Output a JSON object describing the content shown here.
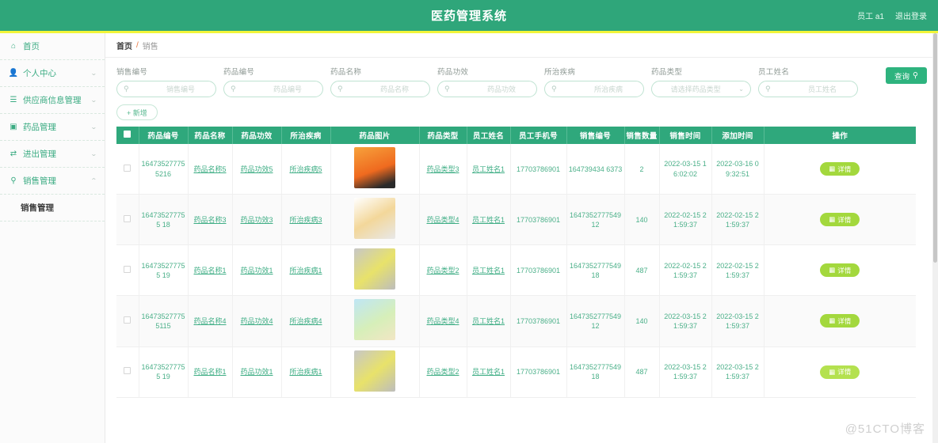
{
  "header": {
    "title": "医药管理系统",
    "user": "员工 a1",
    "logout": "退出登录"
  },
  "sidebar": {
    "items": [
      {
        "label": "首页",
        "icon": "home-icon",
        "glyph": "⌂",
        "arrow": "",
        "active": true
      },
      {
        "label": "个人中心",
        "icon": "user-icon",
        "glyph": "👤",
        "arrow": "⌄"
      },
      {
        "label": "供应商信息管理",
        "icon": "list-icon",
        "glyph": "☰",
        "arrow": "⌄"
      },
      {
        "label": "药品管理",
        "icon": "box-icon",
        "glyph": "▣",
        "arrow": "⌄"
      },
      {
        "label": "进出管理",
        "icon": "transfer-icon",
        "glyph": "⇄",
        "arrow": "⌄"
      },
      {
        "label": "销售管理",
        "icon": "mic-icon",
        "glyph": "⚲",
        "arrow": "⌃"
      }
    ],
    "submenu": [
      {
        "label": "销售管理"
      }
    ]
  },
  "breadcrumb": {
    "home": "首页",
    "separator": "/",
    "current": "销售"
  },
  "filters": {
    "fields": [
      {
        "label": "销售编号",
        "placeholder": "销售编号",
        "value": "",
        "type": "text"
      },
      {
        "label": "药品编号",
        "placeholder": "药品编号",
        "value": "",
        "type": "text"
      },
      {
        "label": "药品名称",
        "placeholder": "药品名称",
        "value": "",
        "type": "text"
      },
      {
        "label": "药品功效",
        "placeholder": "药品功效",
        "value": "",
        "type": "text"
      },
      {
        "label": "所治疾病",
        "placeholder": "所治疾病",
        "value": "",
        "type": "text"
      },
      {
        "label": "药品类型",
        "placeholder": "请选择药品类型",
        "value": "",
        "type": "select"
      },
      {
        "label": "员工姓名",
        "placeholder": "员工姓名",
        "value": "",
        "type": "text"
      }
    ],
    "search_label": "查询",
    "search_icon": "search-icon",
    "add_label": "新增",
    "add_icon": "plus-icon"
  },
  "table": {
    "columns": [
      "药品编号",
      "药品名称",
      "药品功效",
      "所治疾病",
      "药品图片",
      "药品类型",
      "员工姓名",
      "员工手机号",
      "销售编号",
      "销售数量",
      "销售时间",
      "添加时间",
      "操作"
    ],
    "detail_label": "详情",
    "rows": [
      {
        "drug_no": "164735277755216",
        "drug_name": "药品名称5",
        "efficacy": "药品功效5",
        "disease": "所治疾病5",
        "image": "orange-supplement-bottle",
        "drug_type": "药品类型3",
        "staff_name": "员工姓名1",
        "staff_phone": "17703786901",
        "sale_no": "164739434 6373",
        "quantity": "2",
        "sale_time": "2022-03-15 16:02:02",
        "add_time": "2022-03-16 09:32:51"
      },
      {
        "drug_no": "164735277755 18",
        "drug_name": "药品名称3",
        "efficacy": "药品功效3",
        "disease": "所治疾病3",
        "image": "yellow-box-black-bottle",
        "drug_type": "药品类型4",
        "staff_name": "员工姓名1",
        "staff_phone": "17703786901",
        "sale_no": "164735277754912",
        "quantity": "140",
        "sale_time": "2022-02-15 21:59:37",
        "add_time": "2022-02-15 21:59:37"
      },
      {
        "drug_no": "164735277755 19",
        "drug_name": "药品名称1",
        "efficacy": "药品功效1",
        "disease": "所治疾病1",
        "image": "yellow-white-packets",
        "drug_type": "药品类型2",
        "staff_name": "员工姓名1",
        "staff_phone": "17703786901",
        "sale_no": "164735277754918",
        "quantity": "487",
        "sale_time": "2022-02-15 21:59:37",
        "add_time": "2022-02-15 21:59:37"
      },
      {
        "drug_no": "164735277755115",
        "drug_name": "药品名称4",
        "efficacy": "药品功效4",
        "disease": "所治疾病4",
        "image": "green-tea-cup-ad",
        "drug_type": "药品类型4",
        "staff_name": "员工姓名1",
        "staff_phone": "17703786901",
        "sale_no": "164735277754912",
        "quantity": "140",
        "sale_time": "2022-03-15 21:59:37",
        "add_time": "2022-03-15 21:59:37"
      },
      {
        "drug_no": "164735277755 19",
        "drug_name": "药品名称1",
        "efficacy": "药品功效1",
        "disease": "所治疾病1",
        "image": "yellow-white-packets",
        "drug_type": "药品类型2",
        "staff_name": "员工姓名1",
        "staff_phone": "17703786901",
        "sale_no": "164735277754918",
        "quantity": "487",
        "sale_time": "2022-03-15 21:59:37",
        "add_time": "2022-03-15 21:59:37"
      }
    ]
  },
  "watermark": "@51CTO博客",
  "colors": {
    "brand_green": "#2fa67a",
    "accent_yellow": "#f2f53a",
    "table_header": "#2fa87c",
    "link_green": "#3fae85",
    "detail_btn": "#a3d83d"
  }
}
